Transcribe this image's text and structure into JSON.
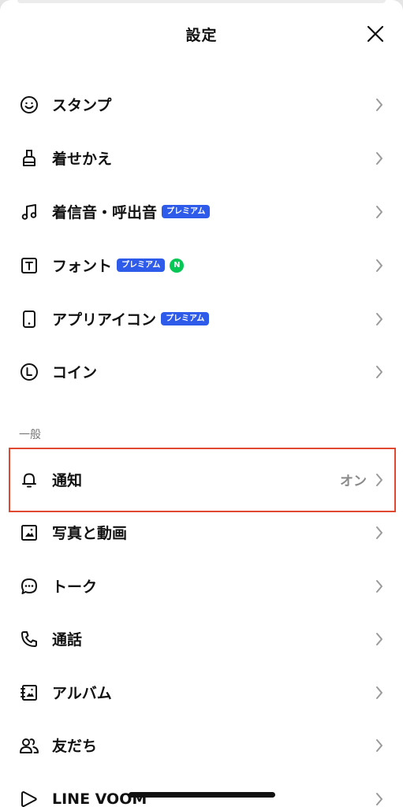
{
  "header": {
    "title": "設定"
  },
  "items_top": [
    {
      "label": "スタンプ",
      "icon": "smiley-icon"
    },
    {
      "label": "着せかえ",
      "icon": "brush-icon"
    },
    {
      "label": "着信音・呼出音",
      "icon": "music-note-icon",
      "badge": "プレミアム"
    },
    {
      "label": "フォント",
      "icon": "font-t-icon",
      "badge": "プレミアム",
      "badge2": "N"
    },
    {
      "label": "アプリアイコン",
      "icon": "phone-icon",
      "badge": "プレミアム"
    },
    {
      "label": "コイン",
      "icon": "coin-icon"
    }
  ],
  "section_general": {
    "title": "一般"
  },
  "items_general": [
    {
      "label": "通知",
      "icon": "bell-icon",
      "value": "オン"
    },
    {
      "label": "写真と動画",
      "icon": "photo-icon"
    },
    {
      "label": "トーク",
      "icon": "chat-bubble-icon"
    },
    {
      "label": "通話",
      "icon": "phone-call-icon"
    },
    {
      "label": "アルバム",
      "icon": "album-icon"
    },
    {
      "label": "友だち",
      "icon": "friends-icon"
    },
    {
      "label": "LINE VOOM",
      "icon": "voom-icon"
    }
  ],
  "colors": {
    "badge_blue": "#2f5bea",
    "badge_green": "#06c755",
    "highlight": "#e0482f"
  }
}
